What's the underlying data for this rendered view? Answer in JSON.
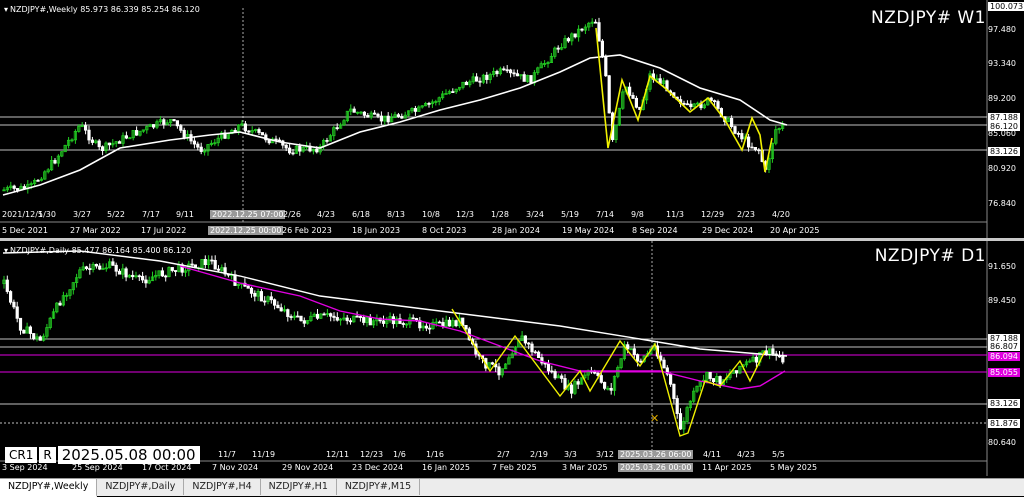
{
  "colors": {
    "background": "#000000",
    "up": "#22cc22",
    "down": "#ffffff",
    "ma_slow": "#ffffff",
    "ma_mid": "#e000e0",
    "zigzag": "#f0f000",
    "hline": "#ffffff"
  },
  "w1": {
    "info_line": "NZDJPY#,Weekly  85.973 86.339 85.254 86.120",
    "title": "NZDJPY# W1",
    "price_labels": [
      "100.073",
      "97.480",
      "93.340",
      "89.200",
      "87.188",
      "86.120",
      "85.060",
      "83.126",
      "80.920",
      "76.840"
    ],
    "date_labels": [
      "5 Dec 2021",
      "27 Mar 2022",
      "17 Jul 2022",
      "2022.12.25 00:00",
      "26 Feb 2023",
      "18 Jun 2023",
      "8 Oct 2023",
      "28 Jan 2024",
      "19 May 2024",
      "8 Sep 2024",
      "29 Dec 2024",
      "20 Apr 2025"
    ],
    "axis_marks": [
      "2021/12/5",
      "1/30",
      "3/27",
      "5/22",
      "7/17",
      "9/11",
      "2022.12.25 07:00",
      "2/26",
      "4/23",
      "6/18",
      "8/13",
      "10/8",
      "12/3",
      "1/28",
      "3/24",
      "5/19",
      "7/14",
      "9/8",
      "11/3",
      "12/29",
      "2/23",
      "4/20"
    ]
  },
  "d1": {
    "info_line": "NZDJPY#,Daily  85.477 86.164 85.400 86.120",
    "title": "NZDJPY# D1",
    "price_labels": [
      "91.650",
      "89.450",
      "87.188",
      "86.807",
      "86.094",
      "85.055",
      "83.126",
      "81.876",
      "80.640"
    ],
    "date_labels": [
      "3 Sep 2024",
      "25 Sep 2024",
      "17 Oct 2024",
      "7 Nov 2024",
      "29 Nov 2024",
      "23 Dec 2024",
      "16 Jan 2025",
      "7 Feb 2025",
      "3 Mar 2025",
      "2025.03.26 00:00",
      "11 Apr 2025",
      "5 May 2025"
    ],
    "axis_marks": [
      "11/7",
      "11/19",
      "12/11",
      "12/23",
      "1/6",
      "1/16",
      "2/7",
      "2/19",
      "3/3",
      "3/12",
      "2025.03.26 06:00",
      "4/11",
      "4/23",
      "5/5"
    ],
    "crosshair": {
      "tag1": "CR1",
      "tag2": "R",
      "datetime": "2025.05.08 00:00"
    }
  },
  "tabs": [
    "NZDJPY#,Weekly",
    "NZDJPY#,Daily",
    "NZDJPY#,H4",
    "NZDJPY#,H1",
    "NZDJPY#,M15"
  ],
  "active_tab": "NZDJPY#,Weekly"
}
